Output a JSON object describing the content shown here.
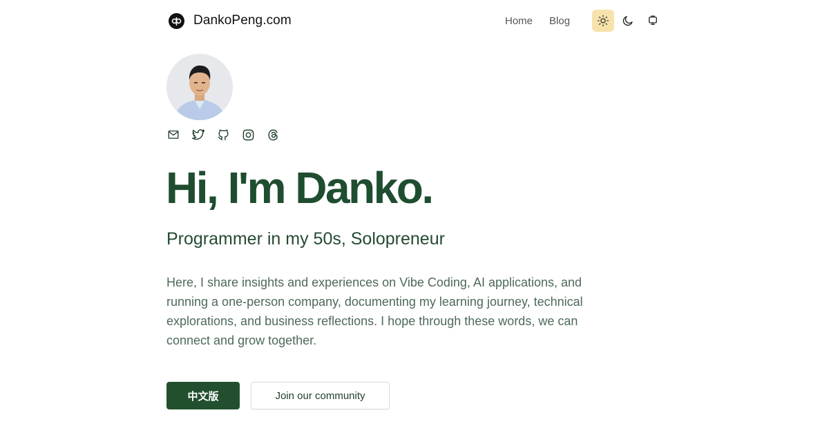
{
  "header": {
    "brand_name": "DankoPeng.com",
    "logo_icon": "dp-logo-icon",
    "nav": [
      {
        "label": "Home"
      },
      {
        "label": "Blog"
      }
    ],
    "theme_options": [
      {
        "icon": "sun-icon",
        "active": true
      },
      {
        "icon": "moon-icon",
        "active": false
      },
      {
        "icon": "monitor-icon",
        "active": false
      }
    ]
  },
  "profile": {
    "avatar": "avatar-photo",
    "social_icons": [
      "mail-icon",
      "twitter-icon",
      "github-icon",
      "instagram-icon",
      "threads-icon"
    ]
  },
  "hero": {
    "title": "Hi, I'm Danko.",
    "subtitle": "Programmer in my 50s, Solopreneur",
    "description": "Here, I share insights and experiences on Vibe Coding, AI applications, and running a one-person company, documenting my learning journey, technical explorations, and business reflections. I hope through these words, we can connect and grow together."
  },
  "buttons": {
    "primary_label": "中文版",
    "secondary_label": "Join our community"
  },
  "colors": {
    "accent": "#22502f",
    "title": "#1f4d30",
    "active_theme_bg": "#f7e2ac"
  }
}
